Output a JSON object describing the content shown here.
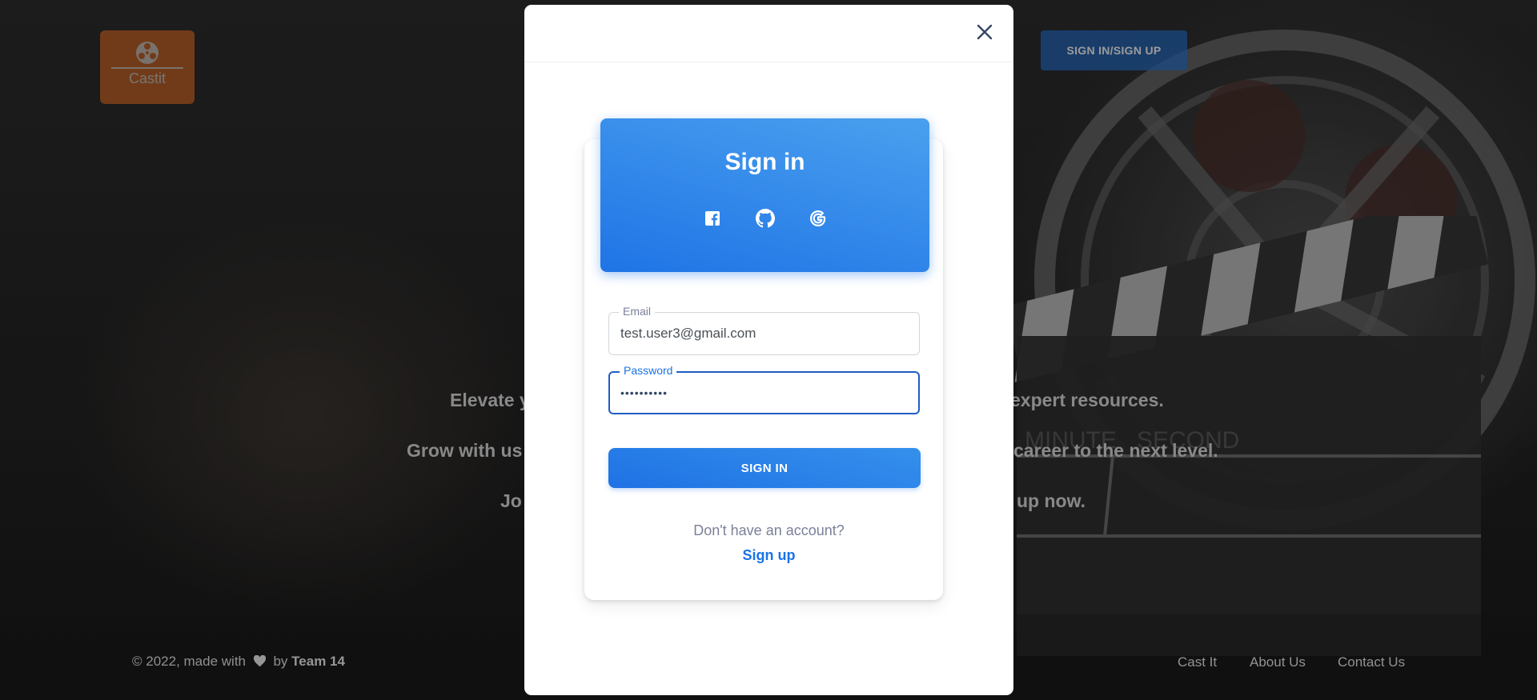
{
  "brand": {
    "name": "Castit",
    "logo_icon": "film-reel-icon",
    "accent": "#e06a1e"
  },
  "header": {
    "auth_button_label": "SIGN IN/SIGN UP"
  },
  "hero": {
    "lines": [
      "Elevate y",
      "expert resources.",
      "Grow with us",
      "career to the next level.",
      "Jo",
      "up now."
    ]
  },
  "footer": {
    "copyright_prefix": "© 2022, made with",
    "copyright_by": "by",
    "team": "Team 14",
    "links": [
      "Cast It",
      "About Us",
      "Contact Us"
    ]
  },
  "modal": {
    "close_icon": "close-icon",
    "title": "Sign in",
    "social": [
      {
        "name": "facebook",
        "icon": "facebook-icon"
      },
      {
        "name": "github",
        "icon": "github-icon"
      },
      {
        "name": "google",
        "icon": "google-icon"
      }
    ],
    "email": {
      "label": "Email",
      "value": "test.user3@gmail.com"
    },
    "password": {
      "label": "Password",
      "value": "••••••••••"
    },
    "submit_label": "SIGN IN",
    "no_account_text": "Don't have an account?",
    "signup_label": "Sign up",
    "colors": {
      "primary": "#1a73e8",
      "close": "#344767"
    }
  }
}
